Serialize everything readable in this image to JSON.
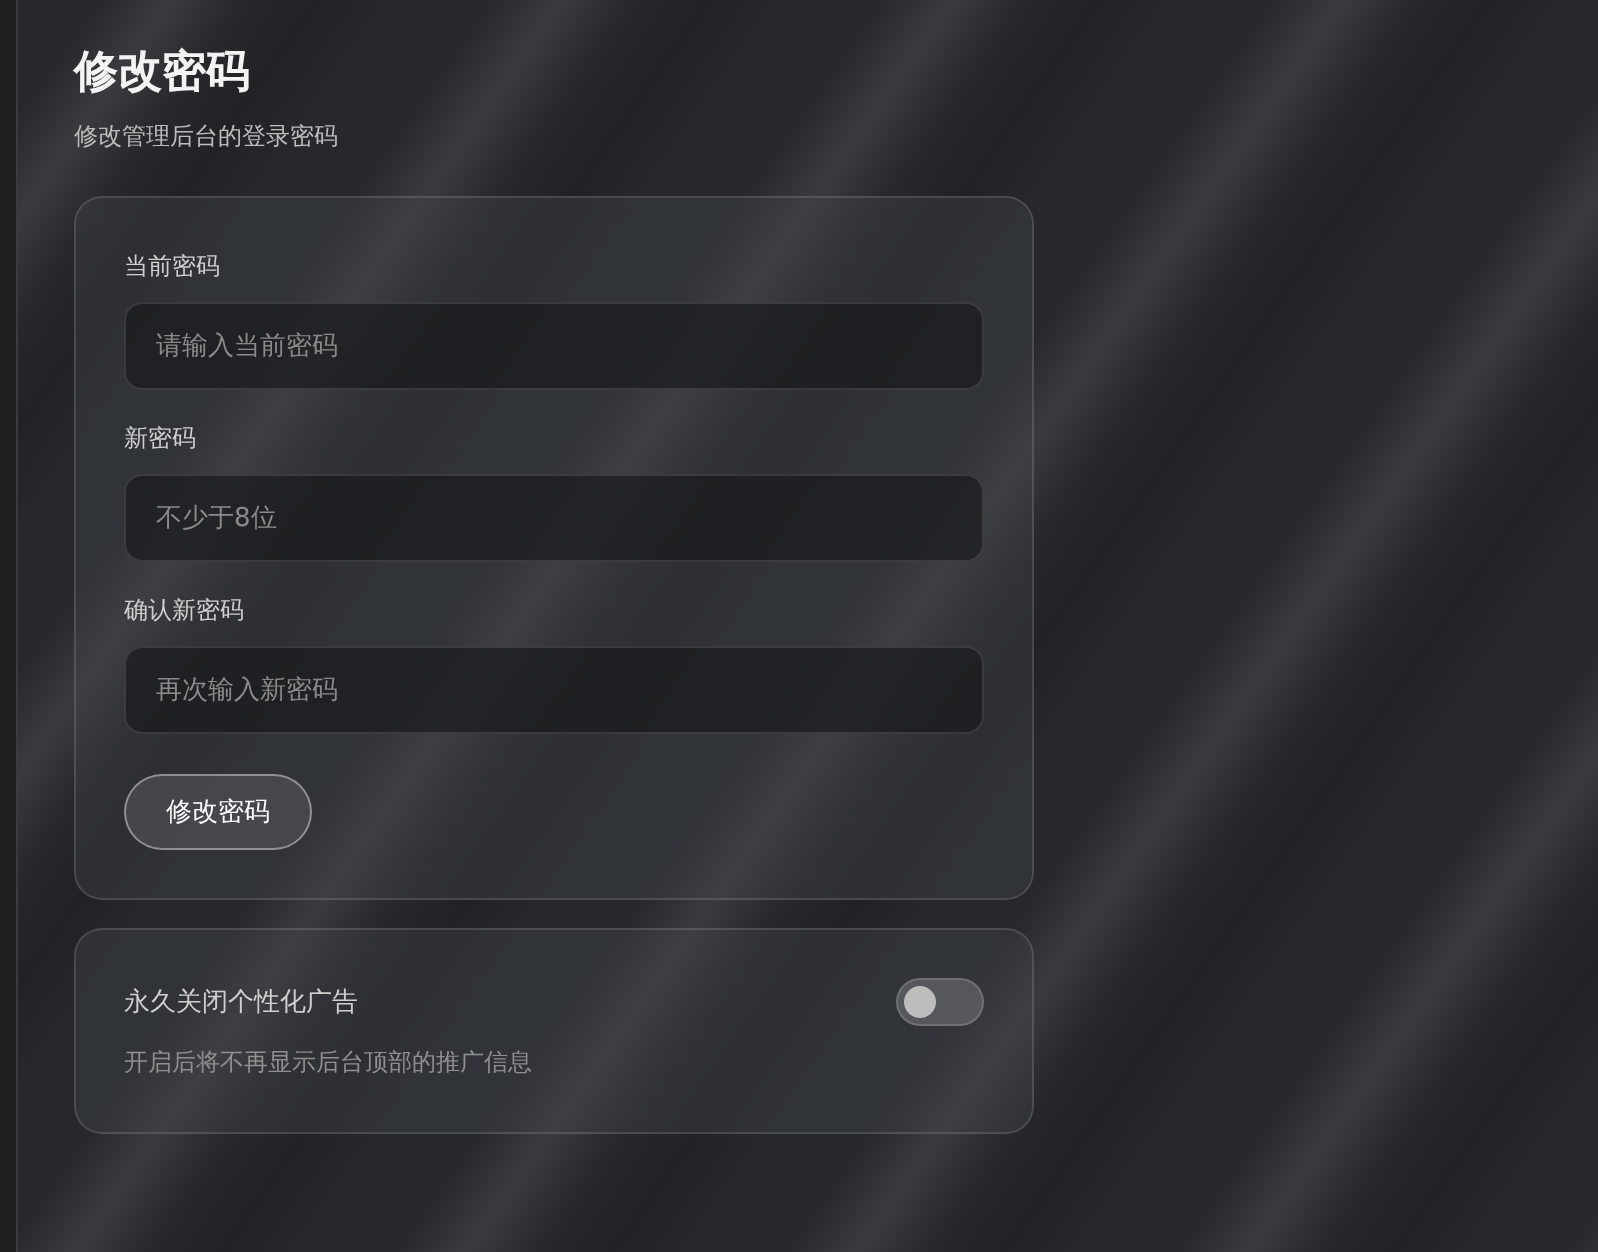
{
  "header": {
    "title": "修改密码",
    "subtitle": "修改管理后台的登录密码"
  },
  "password_form": {
    "fields": [
      {
        "label": "当前密码",
        "placeholder": "请输入当前密码"
      },
      {
        "label": "新密码",
        "placeholder": "不少于8位"
      },
      {
        "label": "确认新密码",
        "placeholder": "再次输入新密码"
      }
    ],
    "submit_button": "修改密码"
  },
  "ad_setting": {
    "label": "永久关闭个性化广告",
    "description": "开启后将不再显示后台顶部的推广信息",
    "on": false
  }
}
